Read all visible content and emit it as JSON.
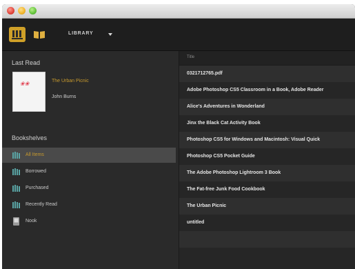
{
  "toolbar": {
    "library_label": "LIBRARY",
    "views": [
      {
        "icon": "bookshelf-grid-icon",
        "active": true
      },
      {
        "icon": "open-book-icon",
        "active": false
      }
    ]
  },
  "sidebar": {
    "last_read": {
      "heading": "Last Read",
      "cover_scribble": "❀❀",
      "book_title": "The Urban Picnic",
      "book_author": "John Burns"
    },
    "bookshelves": {
      "heading": "Bookshelves",
      "items": [
        {
          "label": "All Items",
          "icon": "bookshelf-icon",
          "selected": true
        },
        {
          "label": "Borrowed",
          "icon": "bookshelf-icon",
          "selected": false
        },
        {
          "label": "Purchased",
          "icon": "bookshelf-icon",
          "selected": false
        },
        {
          "label": "Recently Read",
          "icon": "bookshelf-icon",
          "selected": false
        },
        {
          "label": "Nook",
          "icon": "device-icon",
          "selected": false
        }
      ]
    }
  },
  "content": {
    "column_header": "Title",
    "rows": [
      {
        "title": "0321712765.pdf"
      },
      {
        "title": "Adobe Photoshop CS5 Classroom in a Book, Adobe Reader"
      },
      {
        "title": "Alice's Adventures in Wonderland"
      },
      {
        "title": "Jinx the Black Cat Activity Book"
      },
      {
        "title": "Photoshop CS5 for Windows and Macintosh: Visual Quick"
      },
      {
        "title": "Photoshop CS5 Pocket Guide"
      },
      {
        "title": "The Adobe Photoshop Lightroom 3 Book"
      },
      {
        "title": "The Fat-free Junk Food Cookbook"
      },
      {
        "title": "The Urban Picnic"
      },
      {
        "title": "untitled"
      }
    ]
  },
  "colors": {
    "accent": "#cfa028",
    "selected_text": "#c89a2e",
    "shelf_icon": "#5aa6a6"
  }
}
